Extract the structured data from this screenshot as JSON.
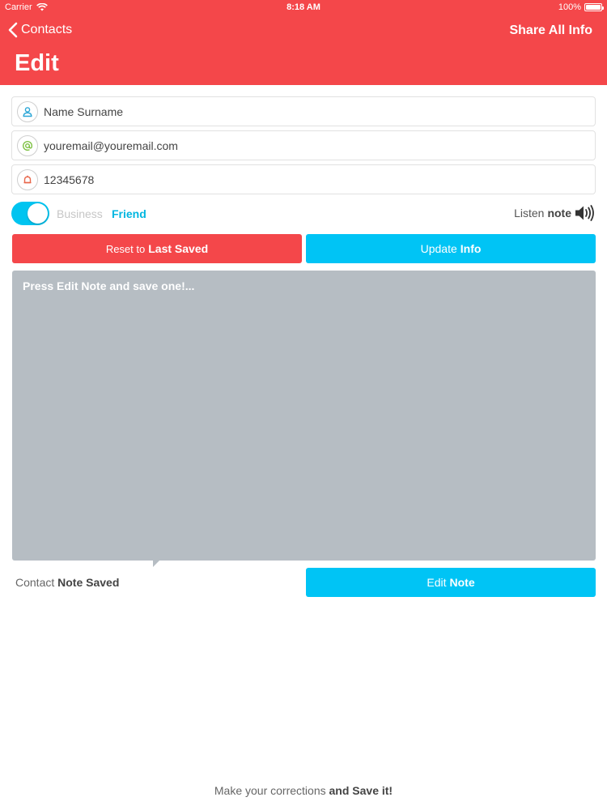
{
  "status_bar": {
    "carrier": "Carrier",
    "time": "8:18 AM",
    "battery": "100%"
  },
  "nav": {
    "back_label": "Contacts",
    "share_label": "Share All Info",
    "title": "Edit"
  },
  "fields": {
    "name": {
      "value": "Name Surname",
      "icon": "person-icon",
      "icon_color": "#2aa6d6"
    },
    "email": {
      "value": "youremail@youremail.com",
      "icon": "at-icon",
      "icon_color": "#7cc040"
    },
    "phone": {
      "value": "12345678",
      "icon": "bell-icon",
      "icon_color": "#e8664a"
    }
  },
  "contact_type": {
    "business_label": "Business",
    "friend_label": "Friend",
    "toggle_on": true
  },
  "listen": {
    "label": "Listen",
    "bold": "note"
  },
  "buttons": {
    "reset_prefix": "Reset to",
    "reset_bold": "Last Saved",
    "update_prefix": "Update",
    "update_bold": "Info",
    "edit_prefix": "Edit",
    "edit_bold": "Note"
  },
  "note": {
    "placeholder": "Press Edit Note and save one!..."
  },
  "saved_status": {
    "prefix": "Contact",
    "bold": "Note Saved"
  },
  "footer": {
    "prefix": "Make your corrections",
    "bold": "and Save it!"
  },
  "colors": {
    "header": "#f4474a",
    "accent": "#00c4f5",
    "note_bg": "#b6bdc3"
  }
}
